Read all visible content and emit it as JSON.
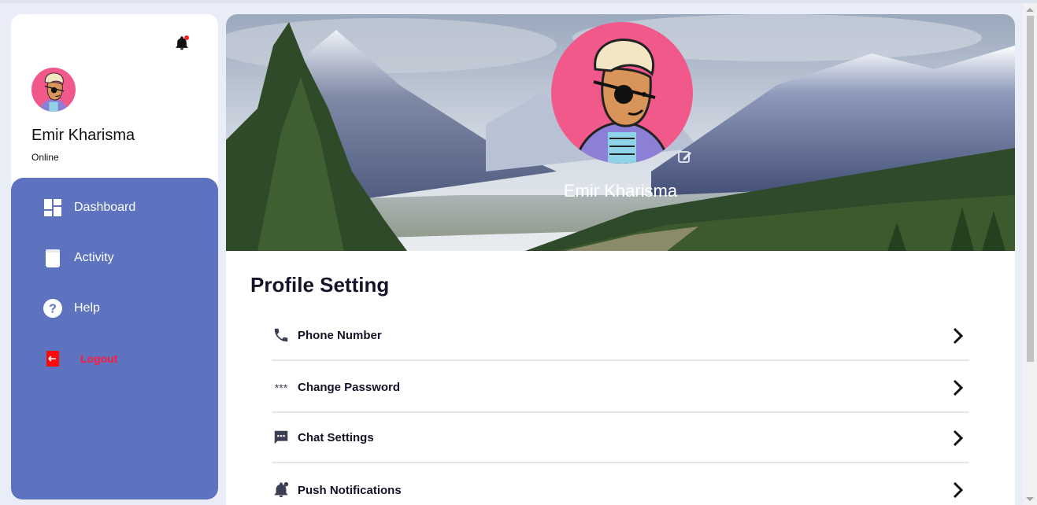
{
  "user": {
    "name": "Emir Kharisma",
    "status": "Online"
  },
  "nav": {
    "items": [
      {
        "label": "Dashboard",
        "icon": "dashboard-grid-icon"
      },
      {
        "label": "Activity",
        "icon": "book-icon"
      },
      {
        "label": "Help",
        "icon": "help-circle-icon"
      }
    ],
    "logout_label": "Logout"
  },
  "banner": {
    "name": "Emir Kharisma"
  },
  "main": {
    "title": "Profile Setting",
    "settings": [
      {
        "label": "Phone Number",
        "icon": "phone-icon"
      },
      {
        "label": "Change Password",
        "icon": "password-icon"
      },
      {
        "label": "Chat Settings",
        "icon": "chat-icon"
      },
      {
        "label": "Push Notifications",
        "icon": "notification-bell-icon"
      }
    ]
  },
  "colors": {
    "sidebar_nav": "#5e73c0",
    "logout": "#ff1a3c",
    "avatar_bg": "#f2598b",
    "notification_dot": "#ff2020",
    "text_dark": "#14132a"
  }
}
